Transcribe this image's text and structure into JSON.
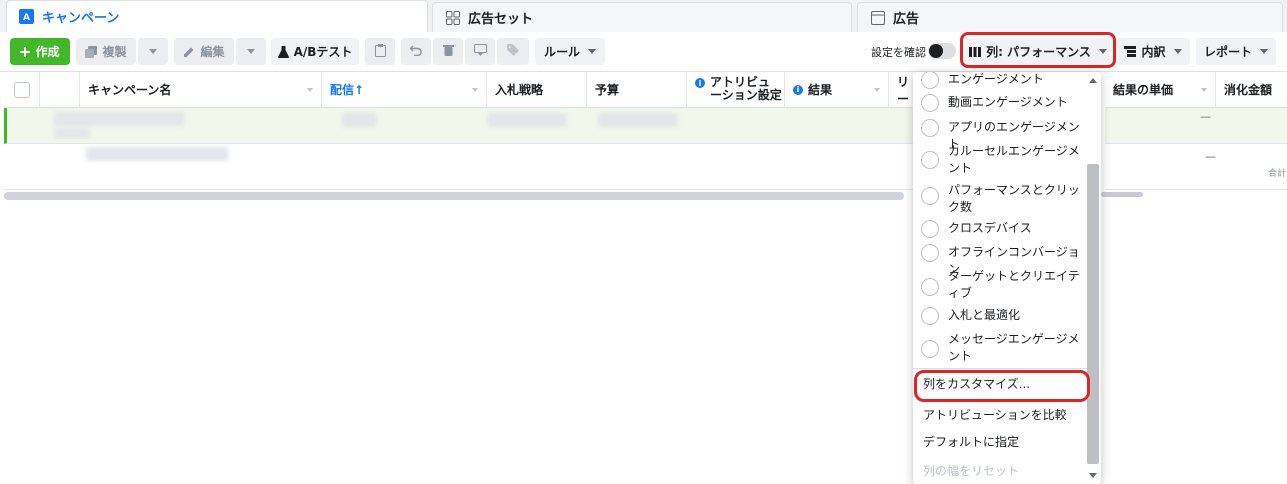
{
  "tabs": [
    {
      "label": "キャンペーン",
      "active": true
    },
    {
      "label": "広告セット",
      "active": false
    },
    {
      "label": "広告",
      "active": false
    }
  ],
  "toolbar": {
    "create_label": "作成",
    "duplicate_label": "複製",
    "edit_label": "編集",
    "ab_test_label": "A/Bテスト",
    "rules_label": "ルール",
    "review_setting_label": "設定を確認",
    "columns_label": "列: パフォーマンス",
    "breakdown_label": "内訳",
    "reports_label": "レポート"
  },
  "table": {
    "headers": [
      "キャンペーン名",
      "配信↑",
      "入札戦略",
      "予算",
      "アトリビュ\nーション設定",
      "結果",
      "リー",
      "結果の単価",
      "消化金額"
    ],
    "row1_cost_per_result": "—",
    "row2_cost_per_result": "—",
    "row2_total_label": "合計"
  },
  "columns_menu": {
    "presets": [
      "エンゲージメント",
      "動画エンゲージメント",
      "アプリのエンゲージメント",
      "カルーセルエンゲージメント",
      "パフォーマンスとクリック数",
      "クロスデバイス",
      "オフラインコンバージョン",
      "ターゲットとクリエイティブ",
      "入札と最適化",
      "メッセージエンゲージメント"
    ],
    "customize_label": "列をカスタマイズ...",
    "compare_attribution_label": "アトリビューションを比較",
    "set_default_label": "デフォルトに指定",
    "reset_width_label": "列の幅をリセット"
  },
  "colors": {
    "accent": "#1877f2",
    "create_green": "#42b72a",
    "highlight_red": "#e02424",
    "selected_row": "#f1f8eb"
  }
}
